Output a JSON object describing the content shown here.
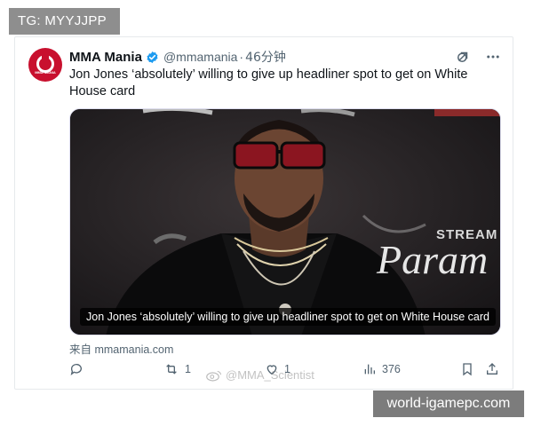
{
  "overlay": {
    "tg_label": "TG: MYYJJPP",
    "site_badge": "world-igamepc.com",
    "watermark_text": "@MMA_Scientist"
  },
  "tweet": {
    "author": "MMA Mania",
    "verified": true,
    "handle": "@mmamania",
    "separator": "·",
    "time": "46分钟",
    "text": "Jon Jones ‘absolutely’ willing to give up headliner spot to get on White House card",
    "media_caption": "Jon Jones ‘absolutely’ willing to give up headliner spot to get on White House card",
    "media_background_text": "STREAM",
    "media_logo_text": "Param",
    "source": "来自 mmamania.com",
    "avatar_text": "MMA MANIA",
    "stats": {
      "replies": "",
      "retweets": "1",
      "likes": "1",
      "views": "376"
    }
  },
  "icons": {
    "grok": "grok-icon",
    "more": "more-icon",
    "reply": "reply-icon",
    "retweet": "retweet-icon",
    "like": "heart-icon",
    "views": "views-icon",
    "bookmark": "bookmark-icon",
    "share": "share-icon"
  },
  "colors": {
    "brand_red": "#c8102e",
    "verified_blue": "#1d9bf0",
    "muted_text": "#536471"
  }
}
